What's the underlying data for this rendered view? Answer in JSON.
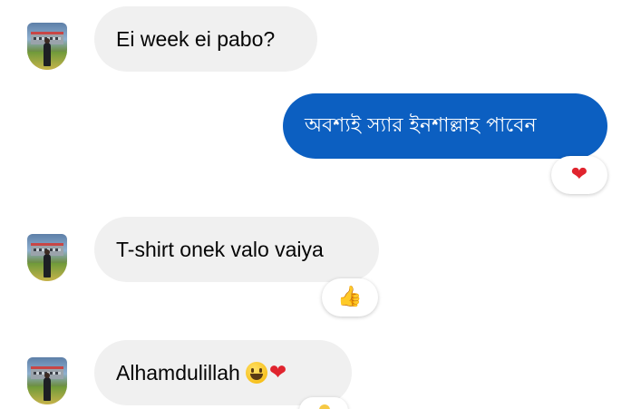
{
  "messages": [
    {
      "direction": "incoming",
      "text": "Ei week ei pabo?"
    },
    {
      "direction": "outgoing",
      "text": "অবশ্যই স্যার ইনশাল্লাহ পাবেন",
      "reaction": "heart",
      "reaction_glyph": "❤"
    },
    {
      "direction": "incoming",
      "text": "T-shirt onek valo vaiya",
      "reaction": "thumbs-up",
      "reaction_glyph": "👍"
    },
    {
      "direction": "incoming",
      "text": "Alhamdulillah",
      "emoji_glyphs": [
        "smiling-face",
        "❤"
      ]
    }
  ],
  "colors": {
    "incoming_bubble": "#f0f0f0",
    "outgoing_bubble": "#0c5fc1",
    "heart": "#e0242e"
  },
  "icons": [
    "avatar-photo",
    "heart-reaction-icon",
    "thumbs-up-reaction-icon",
    "grinning-face-emoji-icon",
    "heart-emoji-icon"
  ]
}
